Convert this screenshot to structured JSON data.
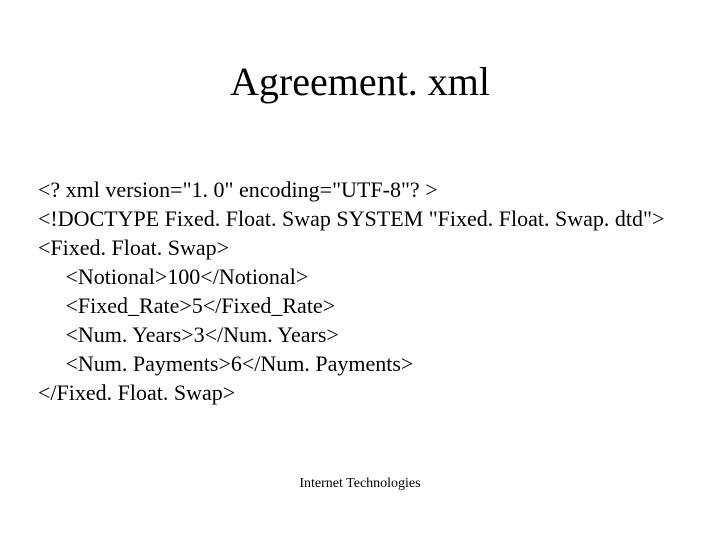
{
  "title": "Agreement. xml",
  "code": {
    "line1": "<? xml version=\"1. 0\" encoding=\"UTF-8\"? >",
    "line2": "<!DOCTYPE Fixed. Float. Swap SYSTEM \"Fixed. Float. Swap. dtd\">",
    "line3": "<Fixed. Float. Swap>",
    "line4": "     <Notional>100</Notional>",
    "line5": "     <Fixed_Rate>5</Fixed_Rate>",
    "line6": "     <Num. Years>3</Num. Years>",
    "line7": "     <Num. Payments>6</Num. Payments>",
    "line8": "</Fixed. Float. Swap>"
  },
  "footer": "Internet Technologies"
}
